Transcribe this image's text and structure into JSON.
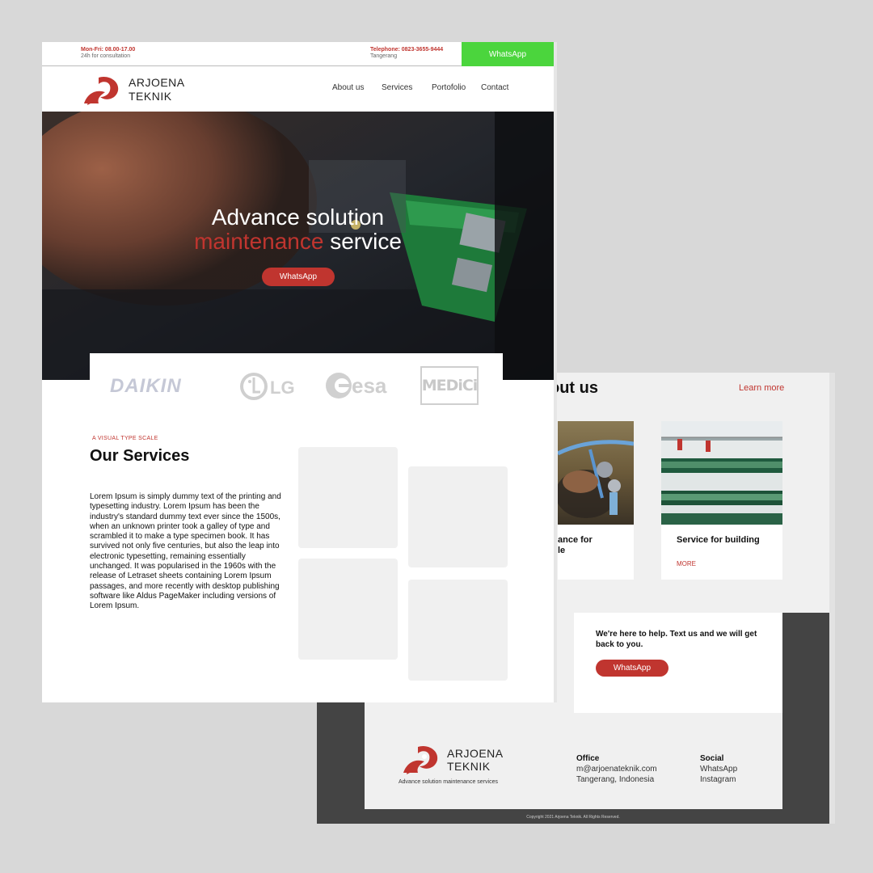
{
  "front": {
    "topbar": {
      "hours": "Mon-Fri: 08.00-17.00",
      "hours_note": "24h for consultation",
      "phone": "Telephone: 0823-3655-9444",
      "location": "Tangerang",
      "whatsapp_label": "WhatsApp"
    },
    "nav": {
      "brand_line1": "ARJOENA",
      "brand_line2": "TEKNIK",
      "links": [
        "About us",
        "Services",
        "Portofolio",
        "Contact"
      ]
    },
    "hero": {
      "title_line1": "Advance solution",
      "title_red": "maintenance",
      "title_rest": " service",
      "button_label": "WhatsApp"
    },
    "brands": [
      "DAIKIN",
      "LG",
      "esa",
      "MEDiCi"
    ],
    "services": {
      "kicker": "A VISUAL TYPE SCALE",
      "title": "Our Services",
      "body": "Lorem Ipsum is simply dummy text of the printing and typesetting industry. Lorem Ipsum has been the industry's standard dummy text ever since the 1500s, when an unknown printer took a galley of type and scrambled it to make a type specimen book. It has survived not only five centuries, but also the leap into electronic typesetting, remaining essentially unchanged. It was popularised in the 1960s with the release of Letraset sheets containing Lorem Ipsum passages, and more recently with desktop publishing software like Aldus PageMaker including versions of Lorem Ipsum."
    }
  },
  "back": {
    "about_title": "out us",
    "learn_more": "Learn more",
    "cards": [
      {
        "title": "ance for\nle",
        "more": ""
      },
      {
        "title": "Service for building",
        "more": "MORE"
      }
    ],
    "help": {
      "text": "We're here to help. Text us and we will get back to you.",
      "button_label": "WhatsApp"
    },
    "footer": {
      "brand_line1": "ARJOENA",
      "brand_line2": "TEKNIK",
      "tagline": "Advance solution maintenance services",
      "office_heading": "Office",
      "office_email": "m@arjoenateknik.com",
      "office_city": "Tangerang, Indonesia",
      "social_heading": "Social",
      "social_links": [
        "WhatsApp",
        "Instagram"
      ],
      "copyright": "Copyright 2021 Arjoena Teknik. All Rights Reserved."
    }
  },
  "colors": {
    "accent": "#c0352f",
    "whatsapp_green": "#4bd53d",
    "placeholder": "#f0f0f0",
    "dark": "#444444"
  },
  "icons": [
    "arjoena-logo-icon",
    "lg-logo-icon",
    "esa-logo-icon"
  ]
}
